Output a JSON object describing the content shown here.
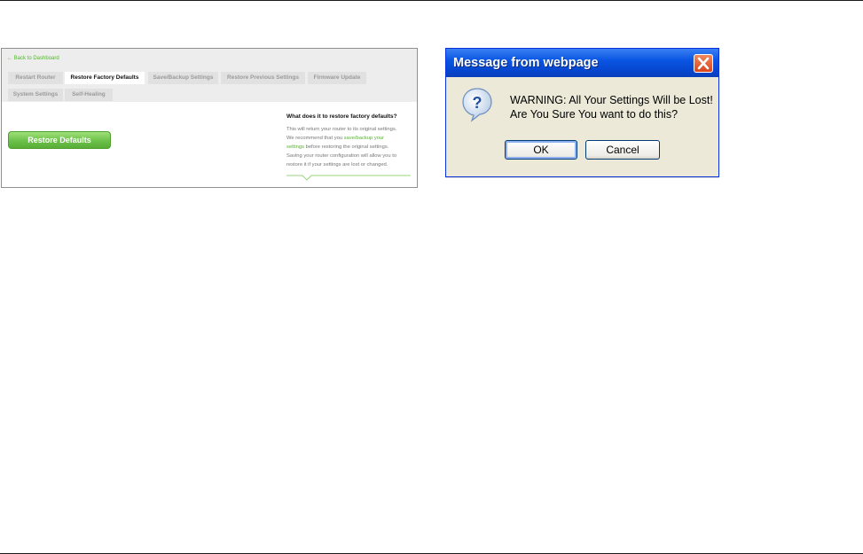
{
  "router": {
    "back_link": "← Back to Dashboard",
    "tabs": [
      {
        "label": "Restart Router",
        "active": false
      },
      {
        "label": "Restore Factory Defaults",
        "active": true
      },
      {
        "label": "Save/Backup Settings",
        "active": false
      },
      {
        "label": "Restore Previous Settings",
        "active": false
      },
      {
        "label": "Firmware Update",
        "active": false
      },
      {
        "label": "System Settings",
        "active": false
      },
      {
        "label": "Self-Healing",
        "active": false
      }
    ],
    "restore_button": "Restore Defaults",
    "help": {
      "title": "What does it to restore factory defaults?",
      "line1": "This will return your router to its original settings.",
      "line2_prefix": "We recommend that you ",
      "line2_link": "save/backup your",
      "line3_link": "settings",
      "line3_suffix": " before restoring the original settings.",
      "line4": "Saving your router configuration will allow you to",
      "line5": "restore it if your settings are lost or changed."
    }
  },
  "dialog": {
    "title": "Message from webpage",
    "message_line1": "WARNING: All Your Settings Will be Lost!",
    "message_line2": "Are You Sure You want to do this?",
    "ok_label": "OK",
    "cancel_label": "Cancel",
    "icons": {
      "question": "question-icon",
      "close": "close-icon"
    }
  },
  "colors": {
    "accent_green": "#55b52f",
    "xp_titlebar_blue": "#0a56e3",
    "close_red": "#d8431d"
  }
}
